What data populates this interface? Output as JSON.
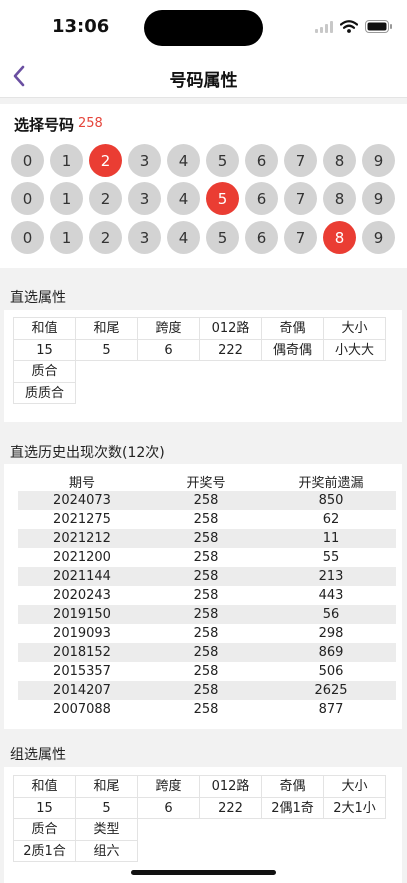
{
  "status": {
    "time": "13:06"
  },
  "nav": {
    "title": "号码属性"
  },
  "picker": {
    "label": "选择号码",
    "value": "258",
    "rows": [
      {
        "digits": [
          "0",
          "1",
          "2",
          "3",
          "4",
          "5",
          "6",
          "7",
          "8",
          "9"
        ],
        "selected": "2"
      },
      {
        "digits": [
          "0",
          "1",
          "2",
          "3",
          "4",
          "5",
          "6",
          "7",
          "8",
          "9"
        ],
        "selected": "5"
      },
      {
        "digits": [
          "0",
          "1",
          "2",
          "3",
          "4",
          "5",
          "6",
          "7",
          "8",
          "9"
        ],
        "selected": "8"
      }
    ],
    "selected_color": "#ea3d33"
  },
  "direct_attrs": {
    "title": "直选属性",
    "cells": [
      {
        "label": "和值",
        "value": "15"
      },
      {
        "label": "和尾",
        "value": "5"
      },
      {
        "label": "跨度",
        "value": "6"
      },
      {
        "label": "012路",
        "value": "222"
      },
      {
        "label": "奇偶",
        "value": "偶奇偶"
      },
      {
        "label": "大小",
        "value": "小大大"
      },
      {
        "label": "质合",
        "value": "质质合"
      }
    ]
  },
  "history": {
    "title": "直选历史出现次数(12次)",
    "headers": [
      "期号",
      "开奖号",
      "开奖前遗漏"
    ],
    "rows": [
      [
        "2024073",
        "258",
        "850"
      ],
      [
        "2021275",
        "258",
        "62"
      ],
      [
        "2021212",
        "258",
        "11"
      ],
      [
        "2021200",
        "258",
        "55"
      ],
      [
        "2021144",
        "258",
        "213"
      ],
      [
        "2020243",
        "258",
        "443"
      ],
      [
        "2019150",
        "258",
        "56"
      ],
      [
        "2019093",
        "258",
        "298"
      ],
      [
        "2018152",
        "258",
        "869"
      ],
      [
        "2015357",
        "258",
        "506"
      ],
      [
        "2014207",
        "258",
        "2625"
      ],
      [
        "2007088",
        "258",
        "877"
      ]
    ]
  },
  "group_attrs": {
    "title": "组选属性",
    "cells": [
      {
        "label": "和值",
        "value": "15"
      },
      {
        "label": "和尾",
        "value": "5"
      },
      {
        "label": "跨度",
        "value": "6"
      },
      {
        "label": "012路",
        "value": "222"
      },
      {
        "label": "奇偶",
        "value": "2偶1奇"
      },
      {
        "label": "大小",
        "value": "2大1小"
      },
      {
        "label": "质合",
        "value": "2质1合"
      },
      {
        "label": "类型",
        "value": "组六"
      }
    ]
  },
  "icons": [
    "back-chevron-icon",
    "signal-icon",
    "wifi-icon",
    "battery-icon"
  ]
}
